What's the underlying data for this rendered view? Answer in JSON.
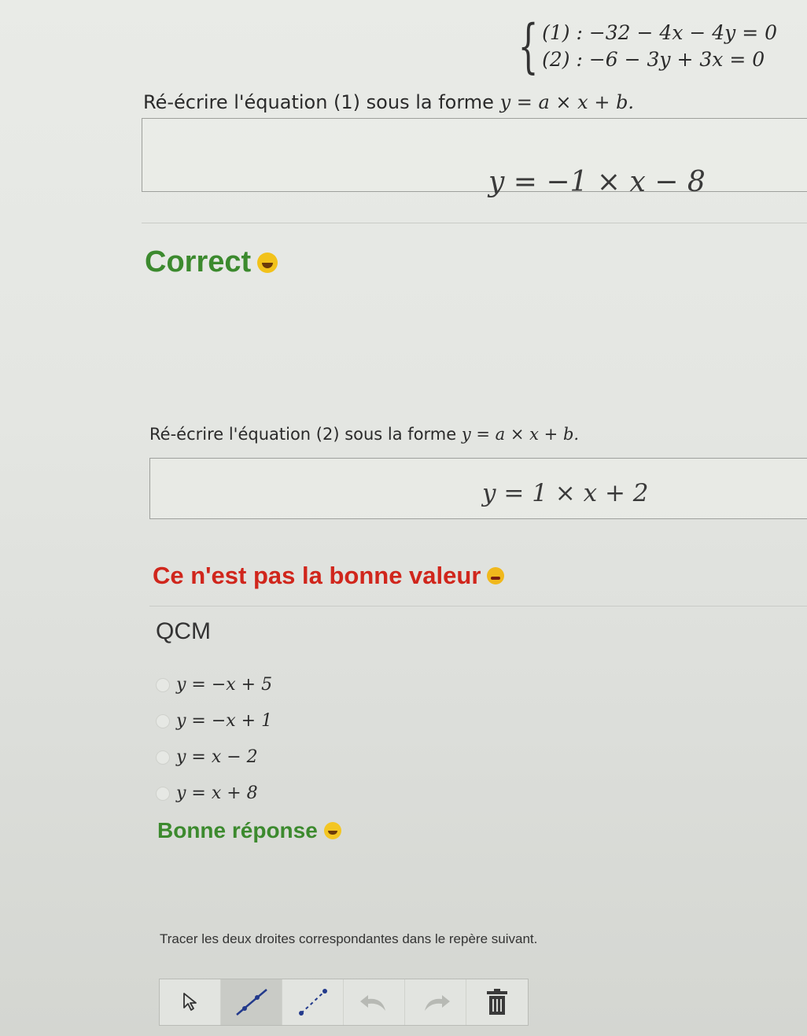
{
  "system": {
    "eq1": "(1) : −32 − 4x − 4y = 0",
    "eq2": "(2) : −6 − 3y + 3x = 0"
  },
  "question1": {
    "prompt": "Ré-écrire l'équation (1) sous la forme",
    "form": "y = a × x + b.",
    "answer": "y = −1 × x − 8",
    "feedback": "Correct",
    "feedback_color": "#3c8a2e",
    "feedback_icon": "smiling-face-icon"
  },
  "question2": {
    "prompt": "Ré-écrire l'équation (2) sous la forme",
    "form": "y = a × x + b.",
    "answer": "y = 1 × x + 2",
    "feedback": "Ce n'est pas la bonne valeur",
    "feedback_color": "#d0261c",
    "feedback_icon": "sad-face-icon"
  },
  "qcm": {
    "title": "QCM",
    "options": [
      "y = −x + 5",
      "y = −x + 1",
      "y = x − 2",
      "y = x + 8"
    ],
    "feedback": "Bonne réponse",
    "feedback_color": "#3c8a2e",
    "feedback_icon": "winking-face-icon"
  },
  "graph": {
    "prompt": "Tracer les deux droites correspondantes dans le repère suivant.",
    "tools": [
      "pointer-icon",
      "line-tool-icon",
      "segment-tool-icon",
      "undo-icon",
      "redo-icon",
      "trash-icon"
    ]
  }
}
